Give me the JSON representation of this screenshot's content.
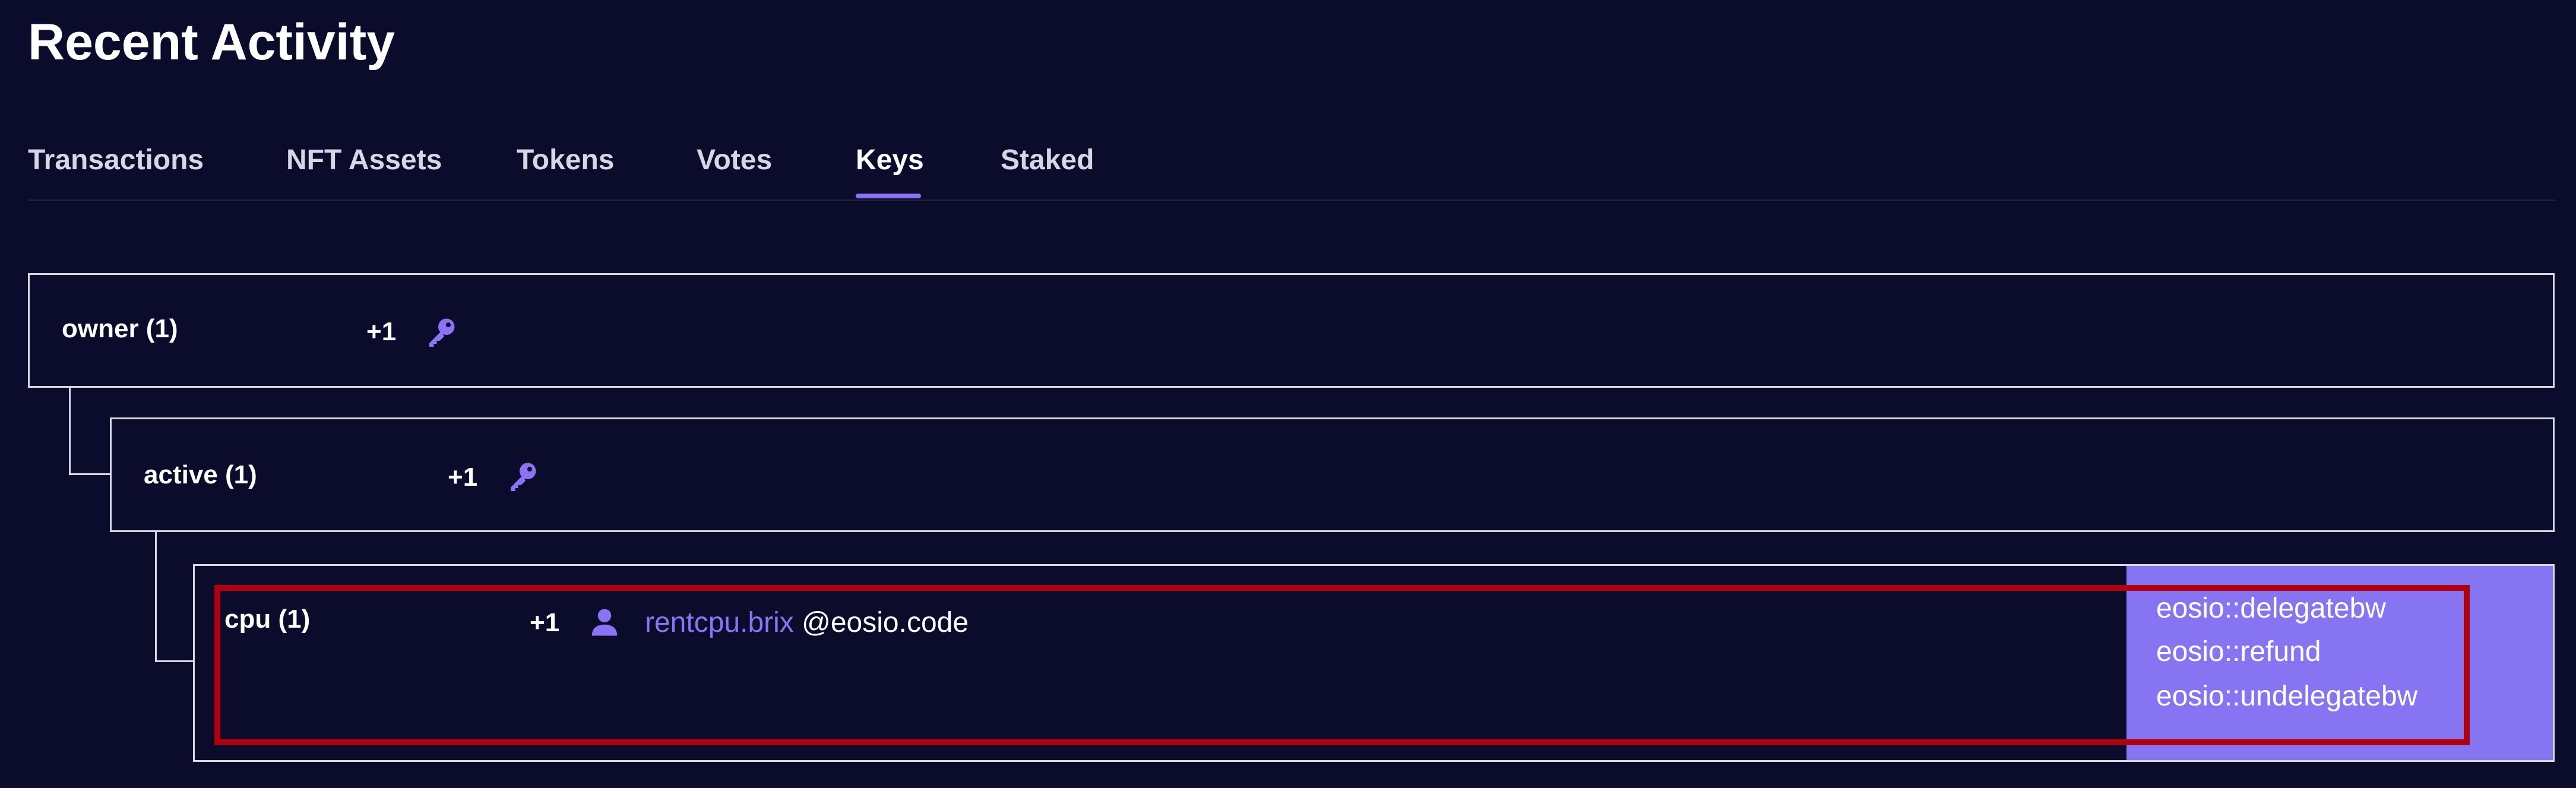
{
  "page": {
    "title": "Recent Activity"
  },
  "tabs": [
    {
      "label": "Transactions",
      "active": false
    },
    {
      "label": "NFT Assets",
      "active": false
    },
    {
      "label": "Tokens",
      "active": false
    },
    {
      "label": "Votes",
      "active": false
    },
    {
      "label": "Keys",
      "active": true
    },
    {
      "label": "Staked",
      "active": false
    }
  ],
  "permissions": {
    "owner": {
      "name": "owner (1)",
      "weight": "+1",
      "icon": "key-icon"
    },
    "active": {
      "name": "active (1)",
      "weight": "+1",
      "icon": "key-icon"
    },
    "cpu": {
      "name": "cpu (1)",
      "weight": "+1",
      "icon": "user-icon",
      "account": "rentcpu.brix",
      "permission": "@eosio.code",
      "actions": [
        "eosio::delegatebw",
        "eosio::refund",
        "eosio::undelegatebw"
      ]
    }
  },
  "colors": {
    "background": "#0b0b2b",
    "accent": "#8a74f5",
    "actions_panel": "#8674f2",
    "highlight": "#b0000e",
    "border": "#d8d8e4"
  }
}
